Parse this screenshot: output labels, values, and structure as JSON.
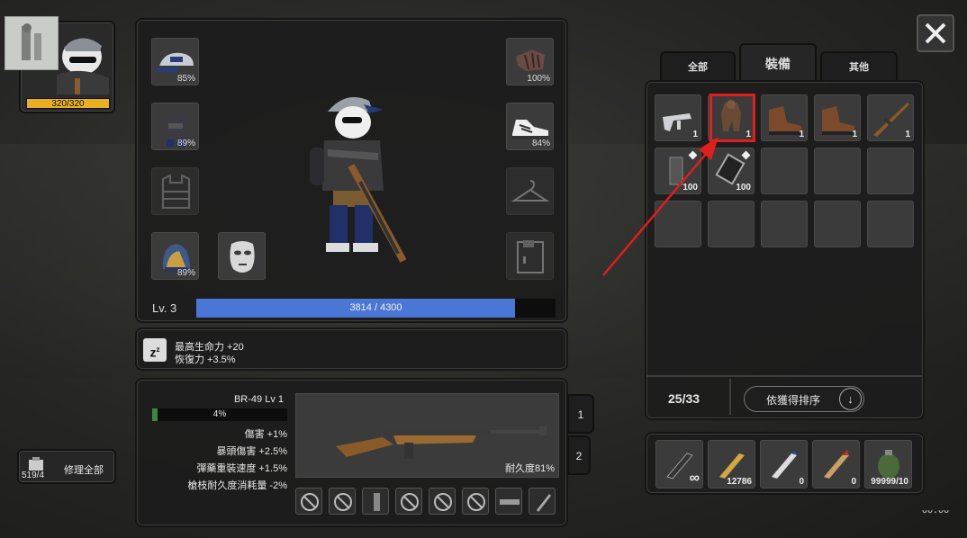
{
  "player": {
    "hp": "320/320",
    "portrait_icon": "panda-portrait-icon"
  },
  "close_icon": "close-icon",
  "equipment": {
    "helmet_pct": "85%",
    "gloves_pct": "100%",
    "armor_top_pct": "89%",
    "shoes_pct": "84%",
    "backpack_pct": "89%",
    "level_label": "Lv. 3",
    "xp_text": "3814 / 4300",
    "xp_fraction": 0.887
  },
  "buffs": {
    "line1": "最高生命力 +20",
    "line2": "恢復力 +3.5%"
  },
  "weapon": {
    "name": "BR-49 Lv 1",
    "progress_text": "4%",
    "progress_fraction": 0.04,
    "stats": [
      "傷害 +1%",
      "暴頭傷害 +2.5%",
      "彈藥重裝速度 +1.5%",
      "槍枝耐久度消耗量 -2%"
    ],
    "durability": "耐久度81%",
    "slot1": "1",
    "slot2": "2"
  },
  "repair": {
    "count": "519/4",
    "label": "修理全部"
  },
  "inventory": {
    "tabs": [
      "全部",
      "裝備",
      "其他"
    ],
    "active_tab": "裝備",
    "items": [
      {
        "icon": "smg-icon",
        "count": "1"
      },
      {
        "icon": "camo-suit-icon",
        "count": "1"
      },
      {
        "icon": "boots-icon",
        "count": "1"
      },
      {
        "icon": "boots-icon",
        "count": "1"
      },
      {
        "icon": "rifle-icon",
        "count": "1"
      },
      {
        "icon": "magazine-icon",
        "count": "100"
      },
      {
        "icon": "armor-plate-icon",
        "count": "100"
      }
    ],
    "capacity": "25/33",
    "sort_label": "依獲得排序"
  },
  "ammo": [
    {
      "icon": "bullet-black-icon",
      "count": "∞"
    },
    {
      "icon": "bullet-gold-icon",
      "count": "12786"
    },
    {
      "icon": "bullet-blue-icon",
      "count": "0"
    },
    {
      "icon": "bullet-red-icon",
      "count": "0"
    },
    {
      "icon": "grenade-icon",
      "count": "99999/10"
    }
  ],
  "colors": {
    "xp_bar": "#4a77d6",
    "hp_bar": "#e8b020",
    "highlight": "#e01e1e",
    "arrow": "#e01e1e"
  }
}
